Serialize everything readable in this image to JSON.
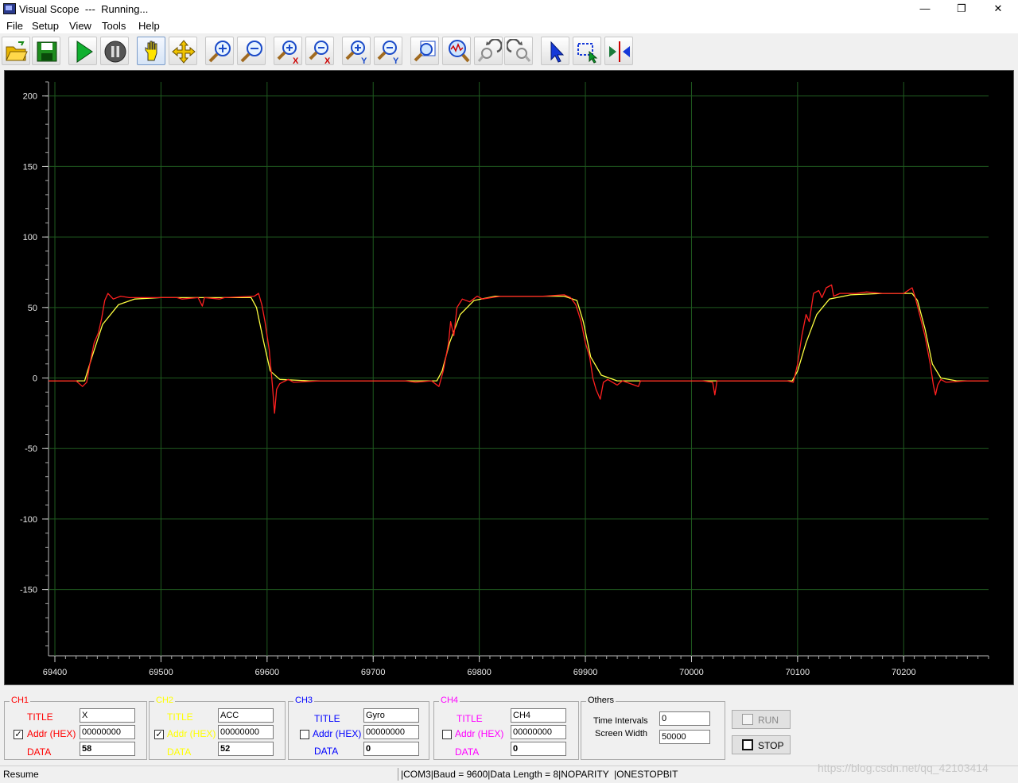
{
  "window": {
    "title": "Visual Scope  ---  Running...",
    "minimize": "—",
    "maximize": "❐",
    "close": "✕"
  },
  "menu": [
    "File",
    "Setup",
    "View",
    "Tools",
    "Help"
  ],
  "toolbar_icons": [
    "open-folder-icon",
    "save-icon",
    "run-icon",
    "pause-icon",
    "hand-pan-icon",
    "move-icon",
    "zoom-in-icon",
    "zoom-out-icon",
    "zoom-in-x-icon",
    "zoom-out-x-icon",
    "zoom-in-y-icon",
    "zoom-out-y-icon",
    "zoom-fit-icon",
    "zoom-signal-icon",
    "zoom-undo-icon",
    "zoom-redo-icon",
    "select-pointer-icon",
    "select-region-icon",
    "cursor-measure-icon"
  ],
  "chart_data": {
    "type": "line",
    "xlim": [
      69394,
      69276.6
    ],
    "x_axis": {
      "min": 69394,
      "max": 70280,
      "ticks": [
        69400,
        69500,
        69600,
        69700,
        69800,
        69900,
        70000,
        70100,
        70200
      ]
    },
    "y_axis": {
      "min": -197,
      "max": 210,
      "ticks": [
        200,
        150,
        100,
        50,
        0,
        -50,
        -100,
        -150
      ]
    },
    "grid": true,
    "background": "#000000",
    "grid_color": "#1f5a1f",
    "series": [
      {
        "color": "#ffff40",
        "points": [
          [
            69394,
            -2
          ],
          [
            69420,
            -2
          ],
          [
            69428,
            -2
          ],
          [
            69435,
            15
          ],
          [
            69445,
            38
          ],
          [
            69460,
            52
          ],
          [
            69475,
            56
          ],
          [
            69500,
            57
          ],
          [
            69560,
            57
          ],
          [
            69585,
            57
          ],
          [
            69590,
            50
          ],
          [
            69597,
            25
          ],
          [
            69603,
            5
          ],
          [
            69612,
            -1
          ],
          [
            69640,
            -2
          ],
          [
            69700,
            -2
          ],
          [
            69760,
            -2
          ],
          [
            69765,
            5
          ],
          [
            69772,
            25
          ],
          [
            69782,
            45
          ],
          [
            69795,
            55
          ],
          [
            69815,
            58
          ],
          [
            69880,
            58
          ],
          [
            69892,
            55
          ],
          [
            69898,
            40
          ],
          [
            69905,
            15
          ],
          [
            69915,
            2
          ],
          [
            69930,
            -2
          ],
          [
            70000,
            -2
          ],
          [
            70095,
            -2
          ],
          [
            70100,
            5
          ],
          [
            70108,
            25
          ],
          [
            70118,
            45
          ],
          [
            70130,
            56
          ],
          [
            70150,
            59
          ],
          [
            70180,
            60
          ],
          [
            70208,
            60
          ],
          [
            70213,
            55
          ],
          [
            70220,
            35
          ],
          [
            70227,
            10
          ],
          [
            70235,
            0
          ],
          [
            70250,
            -2
          ],
          [
            70280,
            -2
          ]
        ]
      },
      {
        "color": "#ff2020",
        "points": [
          [
            69394,
            -2
          ],
          [
            69420,
            -2
          ],
          [
            69426,
            -6
          ],
          [
            69430,
            -3
          ],
          [
            69433,
            10
          ],
          [
            69437,
            25
          ],
          [
            69441,
            32
          ],
          [
            69444,
            42
          ],
          [
            69447,
            55
          ],
          [
            69450,
            60
          ],
          [
            69455,
            56
          ],
          [
            69462,
            58
          ],
          [
            69470,
            57
          ],
          [
            69490,
            57
          ],
          [
            69515,
            57
          ],
          [
            69520,
            56
          ],
          [
            69535,
            57
          ],
          [
            69539,
            51
          ],
          [
            69541,
            57
          ],
          [
            69555,
            56
          ],
          [
            69560,
            57
          ],
          [
            69588,
            58
          ],
          [
            69592,
            60
          ],
          [
            69595,
            52
          ],
          [
            69598,
            40
          ],
          [
            69602,
            20
          ],
          [
            69605,
            -5
          ],
          [
            69607,
            -25
          ],
          [
            69609,
            -8
          ],
          [
            69612,
            -4
          ],
          [
            69620,
            -1
          ],
          [
            69625,
            -3
          ],
          [
            69650,
            -2
          ],
          [
            69680,
            -2
          ],
          [
            69700,
            -2
          ],
          [
            69730,
            -2
          ],
          [
            69740,
            -3
          ],
          [
            69755,
            -2
          ],
          [
            69762,
            -6
          ],
          [
            69766,
            5
          ],
          [
            69771,
            25
          ],
          [
            69773,
            40
          ],
          [
            69776,
            30
          ],
          [
            69779,
            50
          ],
          [
            69784,
            56
          ],
          [
            69791,
            54
          ],
          [
            69798,
            58
          ],
          [
            69803,
            56
          ],
          [
            69820,
            58
          ],
          [
            69860,
            58
          ],
          [
            69880,
            59
          ],
          [
            69886,
            57
          ],
          [
            69891,
            52
          ],
          [
            69896,
            40
          ],
          [
            69900,
            25
          ],
          [
            69904,
            15
          ],
          [
            69907,
            0
          ],
          [
            69910,
            -8
          ],
          [
            69914,
            -15
          ],
          [
            69917,
            -3
          ],
          [
            69921,
            -1
          ],
          [
            69930,
            -5
          ],
          [
            69935,
            -2
          ],
          [
            69950,
            -6
          ],
          [
            69952,
            -2
          ],
          [
            69980,
            -2
          ],
          [
            70010,
            -2
          ],
          [
            70020,
            -3
          ],
          [
            70022,
            -12
          ],
          [
            70024,
            -2
          ],
          [
            70060,
            -2
          ],
          [
            70090,
            -2
          ],
          [
            70096,
            -3
          ],
          [
            70100,
            10
          ],
          [
            70104,
            30
          ],
          [
            70108,
            45
          ],
          [
            70111,
            40
          ],
          [
            70115,
            60
          ],
          [
            70120,
            62
          ],
          [
            70123,
            57
          ],
          [
            70127,
            64
          ],
          [
            70132,
            66
          ],
          [
            70134,
            58
          ],
          [
            70140,
            60
          ],
          [
            70155,
            60
          ],
          [
            70165,
            61
          ],
          [
            70180,
            60
          ],
          [
            70200,
            60
          ],
          [
            70208,
            64
          ],
          [
            70211,
            57
          ],
          [
            70215,
            45
          ],
          [
            70220,
            30
          ],
          [
            70225,
            10
          ],
          [
            70228,
            -5
          ],
          [
            70230,
            -12
          ],
          [
            70232,
            -5
          ],
          [
            70235,
            -1
          ],
          [
            70240,
            -3
          ],
          [
            70260,
            -2
          ],
          [
            70280,
            -2
          ]
        ]
      }
    ]
  },
  "channels": [
    {
      "name": "CH1",
      "title": "X",
      "addr": "00000000",
      "data": "58",
      "checked": true,
      "color": "#ff0000"
    },
    {
      "name": "CH2",
      "title": "ACC",
      "addr": "00000000",
      "data": "52",
      "checked": true,
      "color": "#ffff00"
    },
    {
      "name": "CH3",
      "title": "Gyro",
      "addr": "00000000",
      "data": "0",
      "checked": false,
      "color": "#0000ff"
    },
    {
      "name": "CH4",
      "title": "CH4",
      "addr": "00000000",
      "data": "0",
      "checked": false,
      "color": "#ff00ff"
    }
  ],
  "labels": {
    "title": "TITLE",
    "addr": "Addr (HEX)",
    "data": "DATA"
  },
  "others": {
    "caption": "Others",
    "time_intervals_label": "Time Intervals",
    "time_intervals_value": "0",
    "screen_width_label": "Screen Width",
    "screen_width_value": "50000"
  },
  "buttons": {
    "run": "RUN",
    "stop": "STOP"
  },
  "status": {
    "left": "Resume",
    "right": "|COM3|Baud = 9600|Data Length = 8|NOPARITY  |ONESTOPBIT"
  },
  "watermark": "https://blog.csdn.net/qq_42103414"
}
